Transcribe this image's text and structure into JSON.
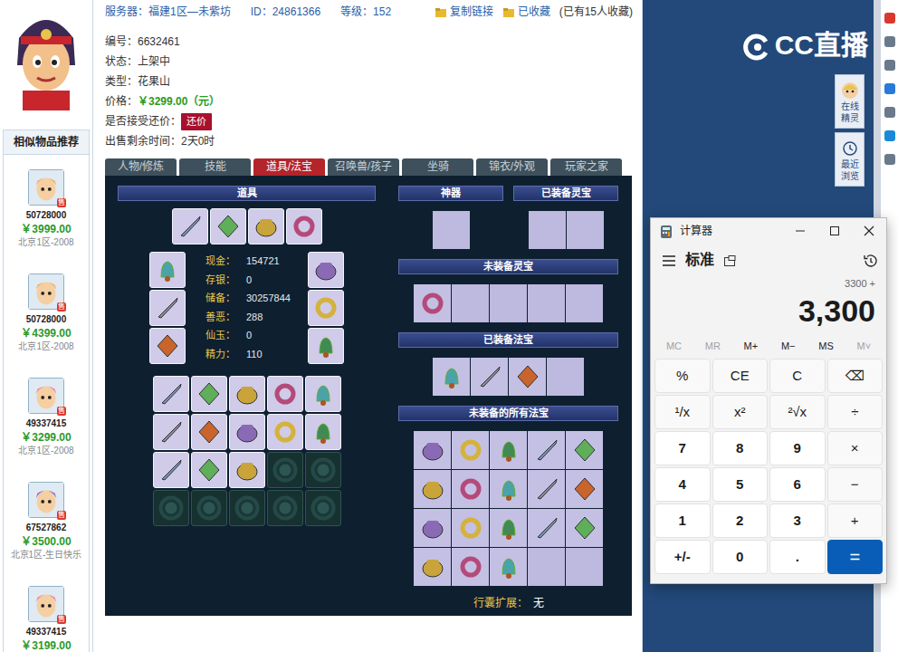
{
  "sidebar": {
    "title": "相似物品推荐",
    "items": [
      {
        "id": "50728000",
        "price": "￥3999.00",
        "server": "北京1区-2008",
        "badge": "售"
      },
      {
        "id": "50728000",
        "price": "￥4399.00",
        "server": "北京1区-2008",
        "badge": "售"
      },
      {
        "id": "49337415",
        "price": "￥3299.00",
        "server": "北京1区-2008",
        "badge": "售"
      },
      {
        "id": "67527862",
        "price": "￥3500.00",
        "server": "北京1区-生日快乐",
        "badge": "售"
      },
      {
        "id": "49337415",
        "price": "￥3199.00",
        "badge": "售"
      }
    ]
  },
  "header": {
    "server_label": "服务器：",
    "server": "福建1区—未紫坊",
    "id_label": "ID：",
    "id": "24861366",
    "level_label": "等级：",
    "level": "152",
    "copy_link": "复制链接",
    "favorited": "已收藏",
    "fav_count": "(已有15人收藏)"
  },
  "details": [
    {
      "label": "编号：",
      "value": "6632461",
      "kind": "text"
    },
    {
      "label": "状态：",
      "value": "上架中",
      "kind": "text"
    },
    {
      "label": "类型：",
      "value": "花果山",
      "kind": "text"
    },
    {
      "label": "价格：",
      "value": "￥3299.00（元）",
      "kind": "price"
    },
    {
      "label": "是否接受还价：",
      "value": "还价",
      "kind": "button"
    },
    {
      "label": "出售剩余时间：",
      "value": "2天0时",
      "kind": "text"
    }
  ],
  "tabs": [
    {
      "label": "人物/修炼",
      "selected": false
    },
    {
      "label": "技能",
      "selected": false
    },
    {
      "label": "道具/法宝",
      "selected": true
    },
    {
      "label": "召唤兽/孩子",
      "selected": false
    },
    {
      "label": "坐骑",
      "selected": false
    },
    {
      "label": "锦衣/外观",
      "selected": false
    },
    {
      "label": "玩家之家",
      "selected": false
    }
  ],
  "items_panel": {
    "title": "道具",
    "top_slots": [
      {
        "filled": true
      },
      {
        "filled": true
      },
      {
        "filled": true
      },
      {
        "filled": true
      }
    ],
    "left_slots": [
      {
        "filled": true
      },
      {
        "filled": true
      },
      {
        "filled": true
      }
    ],
    "right_slots": [
      {
        "filled": true
      },
      {
        "filled": true
      },
      {
        "filled": true
      }
    ],
    "stats": [
      {
        "label": "现金：",
        "value": "154721"
      },
      {
        "label": "存银：",
        "value": "0"
      },
      {
        "label": "储备：",
        "value": "30257844"
      },
      {
        "label": "善恶：",
        "value": "288"
      },
      {
        "label": "仙玉：",
        "value": "0"
      },
      {
        "label": "精力：",
        "value": "110"
      }
    ],
    "inventory": [
      {
        "filled": true
      },
      {
        "filled": true
      },
      {
        "filled": true
      },
      {
        "filled": true
      },
      {
        "filled": true
      },
      {
        "filled": true
      },
      {
        "filled": true
      },
      {
        "filled": true
      },
      {
        "filled": true
      },
      {
        "filled": true
      },
      {
        "filled": true
      },
      {
        "filled": true
      },
      {
        "filled": true
      },
      {
        "filled": false
      },
      {
        "filled": false
      },
      {
        "filled": false
      },
      {
        "filled": false
      },
      {
        "filled": false
      },
      {
        "filled": false
      },
      {
        "filled": false
      }
    ]
  },
  "treasure_panel": {
    "artifact": {
      "title": "神器",
      "slots": [
        {
          "filled": false
        }
      ]
    },
    "equipped_lingbao": {
      "title": "已装备灵宝",
      "slots": [
        {
          "filled": false
        },
        {
          "filled": false
        }
      ]
    },
    "unequipped_lingbao": {
      "title": "未装备灵宝",
      "slots": [
        {
          "filled": true
        },
        {
          "filled": false
        },
        {
          "filled": false
        },
        {
          "filled": false
        },
        {
          "filled": false
        }
      ]
    },
    "equipped_fabao": {
      "title": "已装备法宝",
      "slots": [
        {
          "filled": true
        },
        {
          "filled": true
        },
        {
          "filled": true
        },
        {
          "filled": false
        }
      ]
    },
    "unequipped_fabao": {
      "title": "未装备的所有法宝",
      "slots": [
        {
          "filled": true
        },
        {
          "filled": true
        },
        {
          "filled": true
        },
        {
          "filled": true
        },
        {
          "filled": true
        },
        {
          "filled": true
        },
        {
          "filled": true
        },
        {
          "filled": true
        },
        {
          "filled": true
        },
        {
          "filled": true
        },
        {
          "filled": true
        },
        {
          "filled": true
        },
        {
          "filled": true
        },
        {
          "filled": true
        },
        {
          "filled": true
        },
        {
          "filled": true
        },
        {
          "filled": true
        },
        {
          "filled": true
        },
        {
          "filled": false
        },
        {
          "filled": false
        }
      ]
    },
    "bag_label": "行囊扩展：",
    "bag_value": "无"
  },
  "side_panel": {
    "logo": "CC直播",
    "buttons": [
      "在线精灵",
      "最近浏览"
    ]
  },
  "calculator": {
    "title": "计算器",
    "mode": "标准",
    "history": "3300 +",
    "display": "3,300",
    "memory": [
      {
        "label": "MC",
        "disabled": true
      },
      {
        "label": "MR",
        "disabled": true
      },
      {
        "label": "M+",
        "disabled": false
      },
      {
        "label": "M−",
        "disabled": false
      },
      {
        "label": "MS",
        "disabled": false
      },
      {
        "label": "M˅",
        "disabled": true
      }
    ],
    "keys": [
      {
        "label": "%",
        "kind": "function"
      },
      {
        "label": "CE",
        "kind": "function"
      },
      {
        "label": "C",
        "kind": "function"
      },
      {
        "label": "⌫",
        "kind": "function"
      },
      {
        "label": "¹/x",
        "kind": "function"
      },
      {
        "label": "x²",
        "kind": "function"
      },
      {
        "label": "²√x",
        "kind": "function"
      },
      {
        "label": "÷",
        "kind": "function"
      },
      {
        "label": "7",
        "kind": "digit"
      },
      {
        "label": "8",
        "kind": "digit"
      },
      {
        "label": "9",
        "kind": "digit"
      },
      {
        "label": "×",
        "kind": "function"
      },
      {
        "label": "4",
        "kind": "digit"
      },
      {
        "label": "5",
        "kind": "digit"
      },
      {
        "label": "6",
        "kind": "digit"
      },
      {
        "label": "−",
        "kind": "function"
      },
      {
        "label": "1",
        "kind": "digit"
      },
      {
        "label": "2",
        "kind": "digit"
      },
      {
        "label": "3",
        "kind": "digit"
      },
      {
        "label": "+",
        "kind": "function"
      },
      {
        "label": "+/-",
        "kind": "digit"
      },
      {
        "label": "0",
        "kind": "digit"
      },
      {
        "label": ".",
        "kind": "digit"
      },
      {
        "label": "=",
        "kind": "equals"
      }
    ]
  }
}
